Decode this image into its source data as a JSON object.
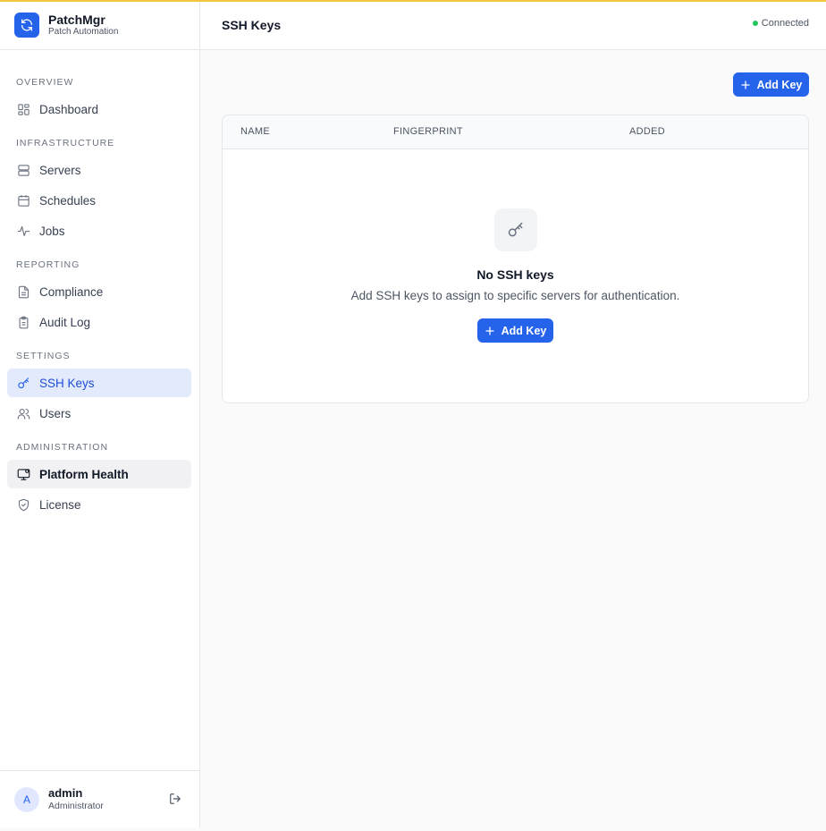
{
  "app": {
    "name": "PatchMgr",
    "subtitle": "Patch Automation"
  },
  "colors": {
    "accent": "#2563eb",
    "top_bar": "#f5c542",
    "status_ok": "#22c55e"
  },
  "sidebar": {
    "sections": [
      {
        "label": "OVERVIEW",
        "items": [
          {
            "label": "Dashboard",
            "icon": "dashboard-icon"
          }
        ]
      },
      {
        "label": "INFRASTRUCTURE",
        "items": [
          {
            "label": "Servers",
            "icon": "server-icon"
          },
          {
            "label": "Schedules",
            "icon": "calendar-icon"
          },
          {
            "label": "Jobs",
            "icon": "activity-icon"
          }
        ]
      },
      {
        "label": "REPORTING",
        "items": [
          {
            "label": "Compliance",
            "icon": "file-text-icon"
          },
          {
            "label": "Audit Log",
            "icon": "clipboard-icon"
          }
        ]
      },
      {
        "label": "SETTINGS",
        "items": [
          {
            "label": "SSH Keys",
            "icon": "key-icon",
            "active": true
          },
          {
            "label": "Users",
            "icon": "users-icon"
          }
        ]
      },
      {
        "label": "ADMINISTRATION",
        "items": [
          {
            "label": "Platform Health",
            "icon": "monitor-icon",
            "hover": true
          },
          {
            "label": "License",
            "icon": "shield-icon"
          }
        ]
      }
    ]
  },
  "user": {
    "initial": "A",
    "name": "admin",
    "role": "Administrator"
  },
  "header": {
    "title": "SSH Keys",
    "status": "Connected"
  },
  "actions": {
    "add_key_label": "Add Key"
  },
  "table": {
    "columns": [
      "NAME",
      "FINGERPRINT",
      "ADDED"
    ],
    "rows": []
  },
  "empty_state": {
    "icon": "key-icon",
    "title": "No SSH keys",
    "description": "Add SSH keys to assign to specific servers for authentication.",
    "button_label": "Add Key"
  }
}
